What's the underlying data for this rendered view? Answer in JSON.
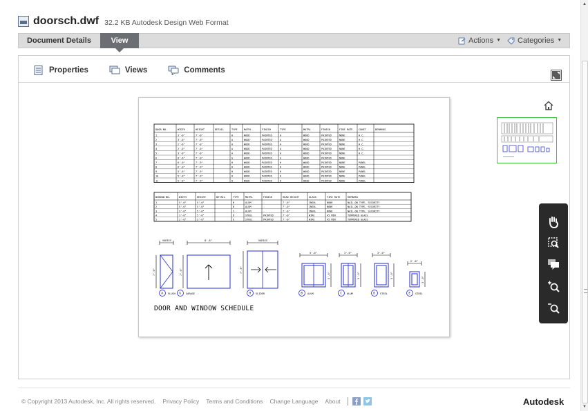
{
  "header": {
    "file_name": "doorsch.dwf",
    "file_meta": "32.2 KB Autodesk Design Web Format"
  },
  "tabs": {
    "details_label": "Document Details",
    "view_label": "View",
    "actions_label": "Actions",
    "categories_label": "Categories"
  },
  "subtabs": {
    "properties": "Properties",
    "views": "Views",
    "comments": "Comments"
  },
  "drawing": {
    "schedule_title": "DOOR AND WINDOW SCHEDULE",
    "door_headers": [
      "DOOR NO.",
      "WIDTH",
      "HEIGHT",
      "DETAIL",
      "TYPE",
      "MATRL",
      "FINISH",
      "TYPE",
      "MATRL",
      "FINISH",
      "FIRE RATE",
      "CONST",
      "REMARKS"
    ],
    "door_rows": [
      [
        "1",
        "3'-0\"",
        "7'-0\"",
        "",
        "A",
        "WOOD",
        "PAINTED",
        "A",
        "WOOD",
        "PAINTED",
        "NONE",
        "H.C.",
        ""
      ],
      [
        "2",
        "3'-0\"",
        "7'-0\"",
        "",
        "A",
        "WOOD",
        "PAINTED",
        "A",
        "WOOD",
        "PAINTED",
        "NONE",
        "H.C.",
        ""
      ],
      [
        "3",
        "2'-6\"",
        "7'-0\"",
        "",
        "A",
        "WOOD",
        "PAINTED",
        "A",
        "WOOD",
        "PAINTED",
        "NONE",
        "H.C.",
        ""
      ],
      [
        "4",
        "2'-0\"",
        "7'-0\"",
        "",
        "A",
        "WOOD",
        "PAINTED",
        "A",
        "WOOD",
        "PAINTED",
        "NONE",
        "H.C.",
        ""
      ],
      [
        "5",
        "3'-0\"",
        "7'-0\"",
        "",
        "A",
        "WOOD",
        "PAINTED",
        "A",
        "WOOD",
        "PAINTED",
        "NONE",
        "H.C.",
        ""
      ],
      [
        "6",
        "8'-6\"",
        "7'-0\"",
        "",
        "G",
        "WOOD",
        "PAINTED",
        "G",
        "WOOD",
        "PAINTED",
        "NONE",
        "-",
        ""
      ],
      [
        "7",
        "6'-0\"",
        "7'-9\"",
        "",
        "H",
        "WOOD",
        "PAINTED",
        "H",
        "WOOD",
        "PAINTED",
        "NONE",
        "PANEL",
        ""
      ],
      [
        "8",
        "6'-0\"",
        "7'-9\"",
        "",
        "H",
        "WOOD",
        "PAINTED",
        "H",
        "WOOD",
        "PAINTED",
        "NONE",
        "PANEL",
        ""
      ],
      [
        "9",
        "5'-6\"",
        "7'-9\"",
        "",
        "H",
        "WOOD",
        "PAINTED",
        "H",
        "WOOD",
        "PAINTED",
        "NONE",
        "PANEL",
        ""
      ],
      [
        "10",
        "5'-0\"",
        "7'-9\"",
        "",
        "H",
        "WOOD",
        "PAINTED",
        "H",
        "WOOD",
        "PAINTED",
        "NONE",
        "PANEL",
        ""
      ],
      [
        "11",
        "5'-0\"",
        "7'-9\"",
        "",
        "H",
        "WOOD",
        "PAINTED",
        "H",
        "WOOD",
        "PAINTED",
        "NONE",
        "PANEL",
        ""
      ]
    ],
    "window_headers": [
      "WINDOW NO.",
      "WIDTH",
      "HEIGHT",
      "DETAIL",
      "TYPE",
      "MATRL",
      "FINISH",
      "HEAD HEIGHT",
      "GLASS",
      "FIRE RATE",
      "REMARKS"
    ],
    "window_rows": [
      [
        "1",
        "5'-0\"",
        "5'-0\"",
        "",
        "B",
        "ALUM",
        "-",
        "7'-0\"",
        "INSUL",
        "NONE",
        "NAIL-ON TYPE, SECURITY"
      ],
      [
        "2",
        "5'-0\"",
        "5'-0\"",
        "",
        "B",
        "ALUM",
        "-",
        "7'-0\"",
        "INSUL",
        "NONE",
        "NAIL-ON TYPE, SECURITY"
      ],
      [
        "3",
        "3'-0\"",
        "5'-0\"",
        "",
        "C",
        "ALUM",
        "-",
        "7'-0\"",
        "INSUL",
        "NONE",
        "NAIL-ON TYPE, SECURITY"
      ],
      [
        "4",
        "3'-0\"",
        "5'-0\"",
        "",
        "D",
        "STEEL",
        "PAINTED",
        "7'-0\"",
        "WIRE",
        "45 MIN",
        "TEMPERED GLASS"
      ],
      [
        "5",
        "2'-0\"",
        "3'-0\"",
        "",
        "E",
        "STEEL",
        "PAINTED",
        "7'-0\"",
        "WIRE",
        "45 MIN",
        "TEMPERED GLASS"
      ]
    ],
    "elevations": [
      {
        "tag": "A",
        "label": "FLUSH",
        "width": "VARIES",
        "height": "7'-0\""
      },
      {
        "tag": "G",
        "label": "GARAGE",
        "width": "8'-6\"",
        "height": "7'-0\""
      },
      {
        "tag": "H",
        "label": "SLIDER",
        "width": "VARIES",
        "height": "7'-9\""
      },
      {
        "tag": "B",
        "label": "ALUM",
        "width": "5'-0\"",
        "height": "5'-0\""
      },
      {
        "tag": "C",
        "label": "ALUM",
        "width": "3'-0\"",
        "height": "5'-0\""
      },
      {
        "tag": "D",
        "label": "STEEL",
        "width": "3'-0\"",
        "height": "5'-0\""
      },
      {
        "tag": "E",
        "label": "STEEL",
        "width": "2'-0\"",
        "height": "3'-0\""
      }
    ]
  },
  "footer": {
    "copyright": "© Copyright 2013 Autodesk, Inc. All rights reserved.",
    "privacy": "Privacy Policy",
    "terms": "Terms and Conditions",
    "language": "Change Language",
    "about": "About",
    "brand": "Autodesk"
  },
  "icons": {
    "file": "dwf-file-icon",
    "actions": "actions-icon",
    "categories": "categories-tag-icon",
    "properties": "properties-icon",
    "views": "views-icon",
    "comments": "comments-icon",
    "expand": "expand-icon",
    "home": "home-icon",
    "tools": [
      "pan-hand-icon",
      "zoom-window-icon",
      "markup-comment-icon",
      "zoom-in-icon",
      "zoom-out-icon"
    ],
    "social": [
      "facebook-icon",
      "twitter-icon"
    ]
  },
  "colors": {
    "view_tab": "#6b6f73",
    "toolbar": "#2a2a2a",
    "thumbnail_border": "#3ec03e",
    "drawing_blue": "#3a3fd0"
  }
}
